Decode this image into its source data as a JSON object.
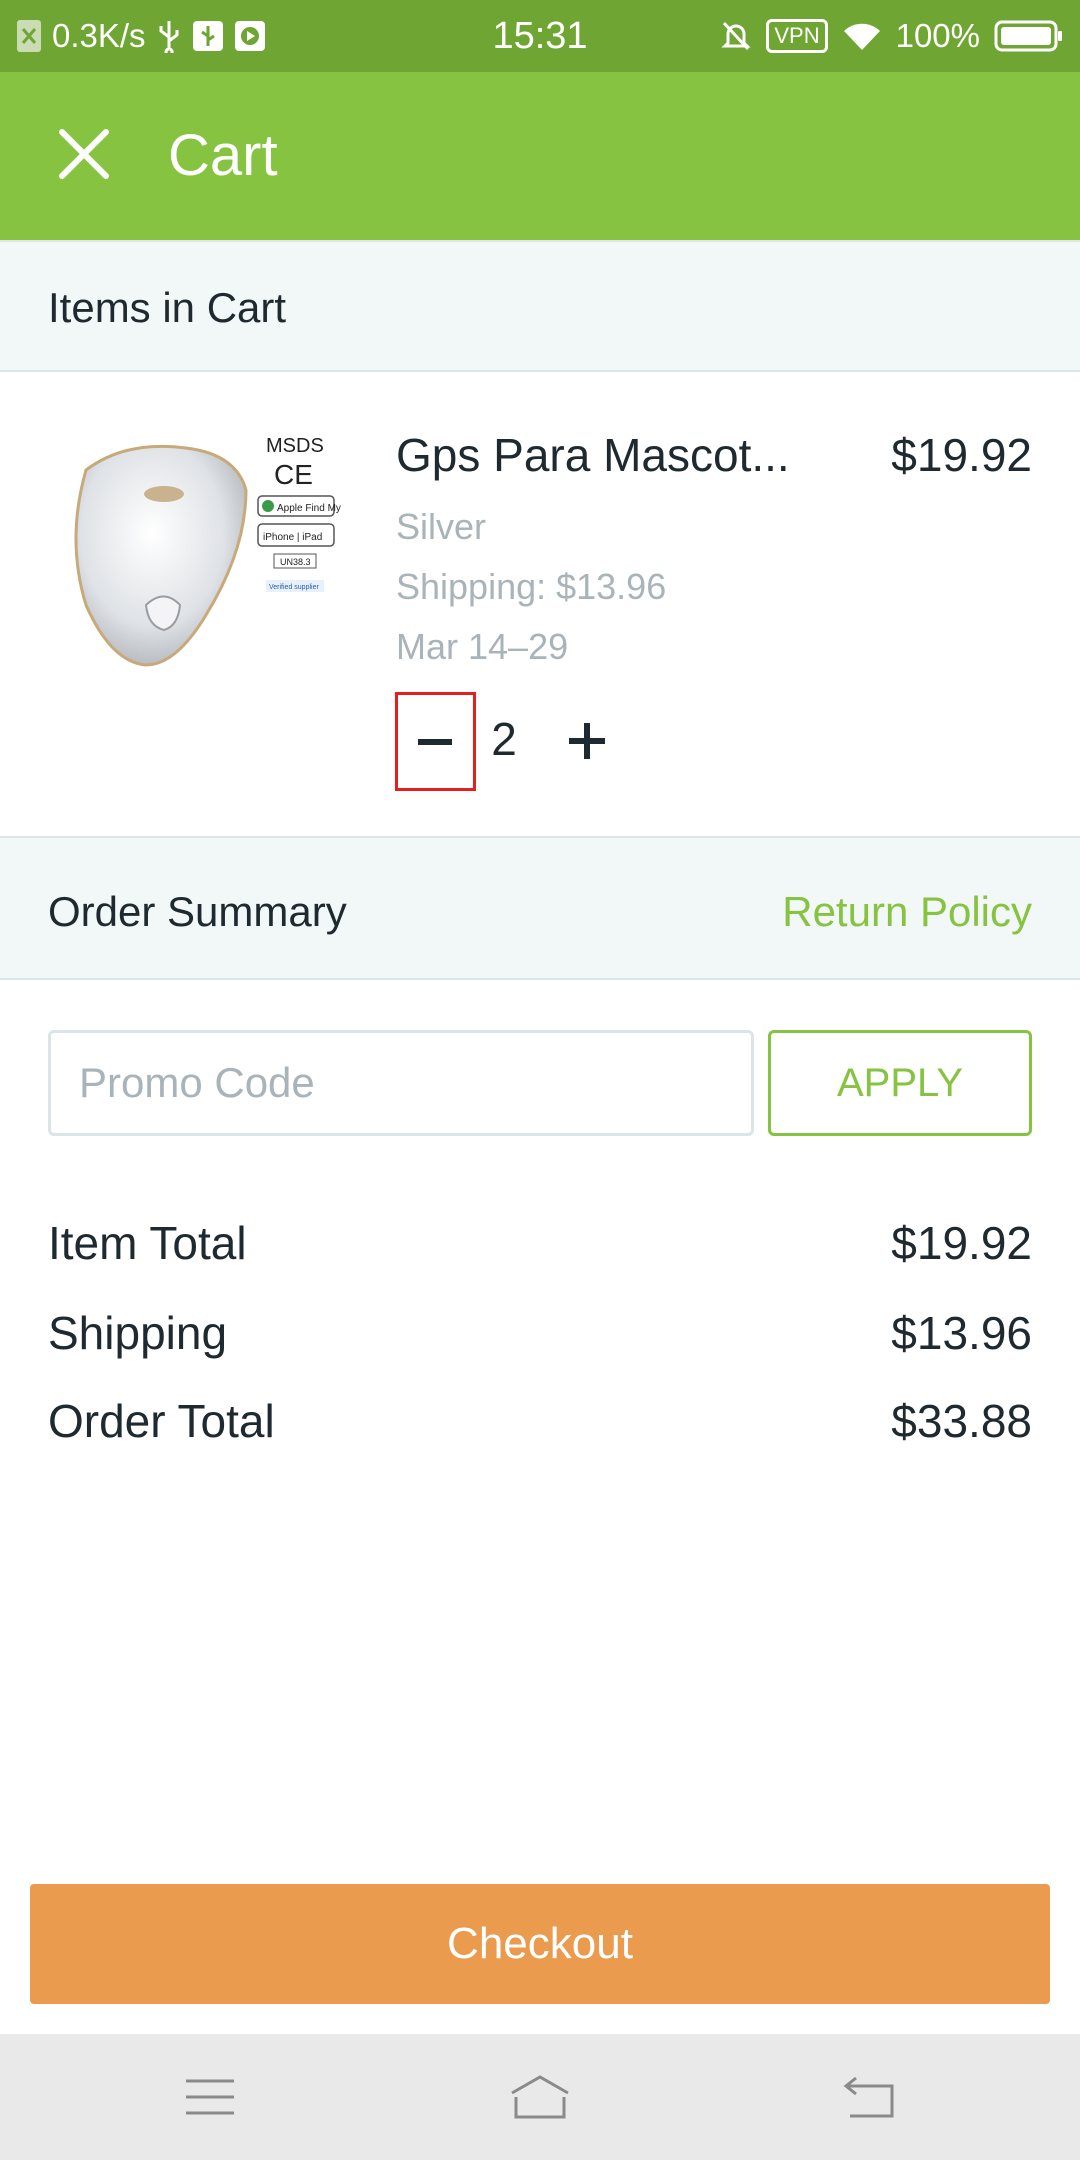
{
  "status_bar": {
    "network_speed": "0.3K/s",
    "time": "15:31",
    "vpn": "VPN",
    "battery": "100%"
  },
  "app_bar": {
    "title": "Cart",
    "close_icon": "close-icon"
  },
  "cart": {
    "section_title": "Items in Cart",
    "item": {
      "name": "Gps Para Mascot...",
      "variant": "Silver",
      "shipping": "Shipping: $13.96",
      "delivery": "Mar 14–29",
      "price": "$19.92",
      "quantity": "2",
      "image_text": {
        "msds": "MSDS",
        "ce": "CE",
        "find_my": "Apple Find My",
        "made_for": "iPhone | iPad",
        "un": "UN38.3",
        "verified": "Verified supplier"
      }
    }
  },
  "summary": {
    "section_title": "Order Summary",
    "return_policy": "Return Policy",
    "promo_placeholder": "Promo Code",
    "apply_label": "APPLY",
    "rows": [
      {
        "label": "Item Total",
        "value": "$19.92"
      },
      {
        "label": "Shipping",
        "value": "$13.96"
      },
      {
        "label": "Order Total",
        "value": "$33.88"
      }
    ]
  },
  "checkout_label": "Checkout",
  "colors": {
    "status_bar": "#6fa532",
    "app_bar": "#86c341",
    "accent": "#86c341",
    "checkout": "#ea9b4d",
    "highlight": "#e32020"
  }
}
